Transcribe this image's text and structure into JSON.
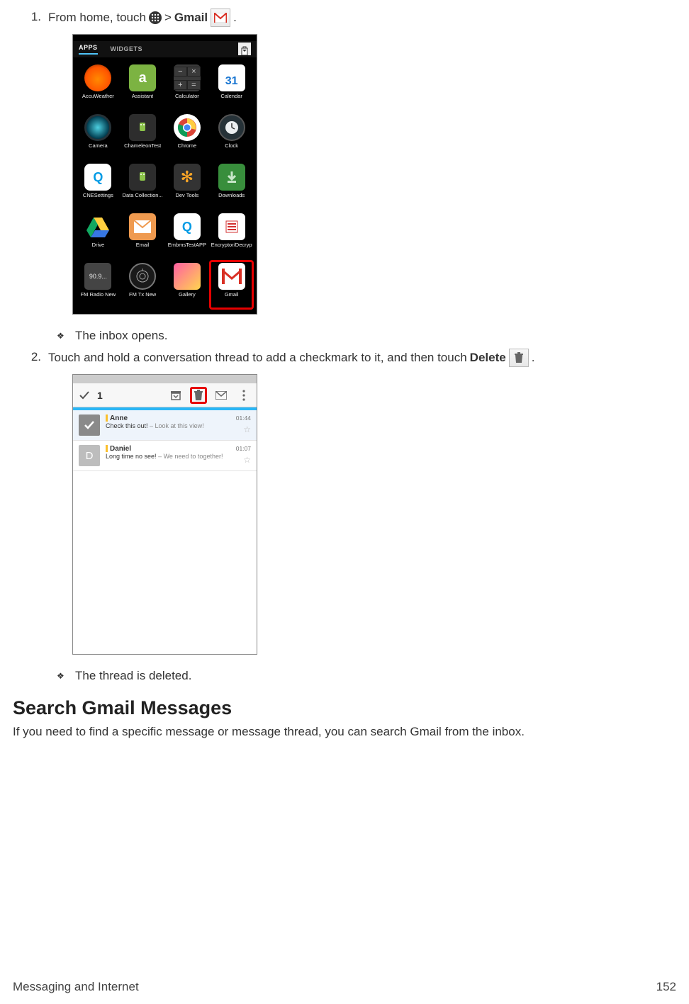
{
  "steps": {
    "s1_num": "1.",
    "s1_a": "From home, touch ",
    "s1_b": " > ",
    "s1_gmail": "Gmail",
    "s1_c": ".",
    "s1_result": "The inbox opens.",
    "s2_num": "2.",
    "s2_a": "Touch and hold a conversation thread to add a checkmark to it, and then touch ",
    "s2_delete": "Delete",
    "s2_b": ".",
    "s2_result": "The thread is deleted."
  },
  "phone1": {
    "tab_apps": "APPS",
    "tab_widgets": "WIDGETS",
    "apps": {
      "accu": "AccuWeather",
      "assist": "Assistant",
      "assist_letter": "a",
      "calc": "Calculator",
      "calendar": "Calendar",
      "cal_num": "31",
      "camera": "Camera",
      "cham": "ChameleonTest",
      "chrome": "Chrome",
      "clock": "Clock",
      "cne": "CNESettings",
      "cne_letter": "Q",
      "datacol": "Data Collection...",
      "dev": "Dev Tools",
      "down": "Downloads",
      "drive": "Drive",
      "email": "Email",
      "embms": "EmbmsTestAPP",
      "embms_letter": "Q",
      "enc": "Encryptor/Decryptor",
      "fmr": "FM Radio New",
      "fmr_label": "90.9...",
      "fmtx": "FM Tx New",
      "gall": "Gallery",
      "gmail": "Gmail"
    }
  },
  "phone2": {
    "count": "1",
    "msg1": {
      "sender": "Anne",
      "subject": "Check this out!",
      "preview": " – Look at this view!",
      "time": "01:44"
    },
    "msg2": {
      "sender": "Daniel",
      "avatar": "D",
      "subject": "Long time no see!",
      "preview": " – We need to together!",
      "time": "01:07"
    }
  },
  "section": {
    "heading": "Search Gmail Messages",
    "para": "If you need to find a specific message or message thread, you can search Gmail from the inbox."
  },
  "footer": {
    "left": "Messaging and Internet",
    "right": "152"
  }
}
